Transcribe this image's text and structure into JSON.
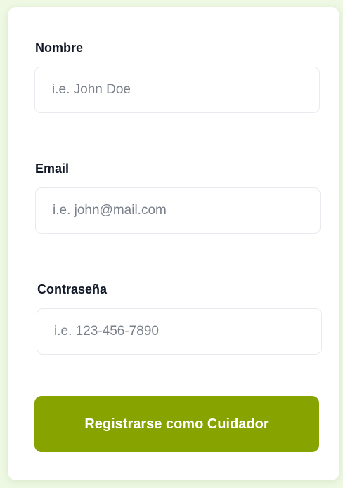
{
  "form": {
    "fields": [
      {
        "label": "Nombre",
        "placeholder": "i.e. John Doe",
        "value": ""
      },
      {
        "label": "Email",
        "placeholder": "i.e. john@mail.com",
        "value": ""
      },
      {
        "label": "Contraseña",
        "placeholder": "i.e. 123-456-7890",
        "value": ""
      }
    ],
    "submit_label": "Registrarse como Cuidador"
  },
  "colors": {
    "background": "#eef8e3",
    "card": "#ffffff",
    "accent": "#86a300",
    "label_text": "#111827",
    "placeholder_text": "#7a808a"
  }
}
